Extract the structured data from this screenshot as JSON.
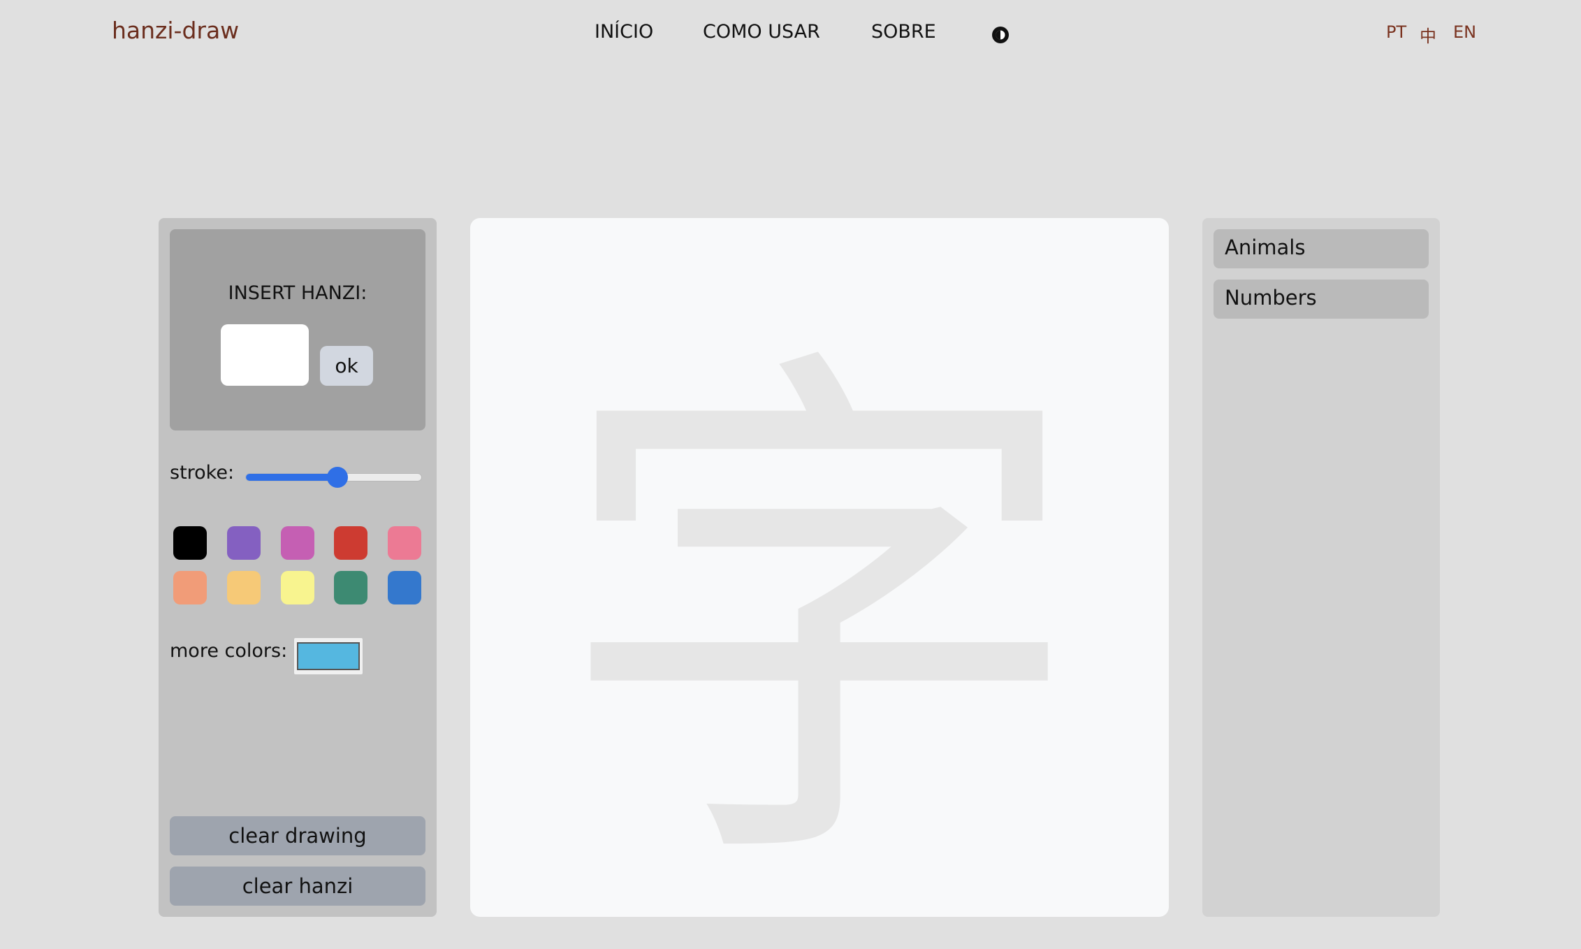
{
  "header": {
    "logo": "hanzi-draw",
    "nav": {
      "inicio": "INÍCIO",
      "como_usar": "COMO USAR",
      "sobre": "SOBRE"
    },
    "theme_icon": "contrast-icon",
    "languages": {
      "pt": "PT",
      "zh": "中",
      "en": "EN"
    }
  },
  "tools": {
    "insert_label": "INSERT HANZI:",
    "hanzi_value": "",
    "ok_label": "ok",
    "stroke_label": "stroke:",
    "stroke_value": 0.52,
    "palette": [
      "#000000",
      "#8460c1",
      "#c55fb3",
      "#cd3b31",
      "#ec7a94",
      "#f19c78",
      "#f6c977",
      "#f8f48f",
      "#3d8a72",
      "#3478cd"
    ],
    "more_colors_label": "more colors:",
    "custom_color": "#55b7e0",
    "clear_drawing_label": "clear drawing",
    "clear_hanzi_label": "clear hanzi"
  },
  "canvas": {
    "guide_character": "字",
    "guide_color": "#e6e6e6"
  },
  "categories": [
    {
      "label": "Animals"
    },
    {
      "label": "Numbers"
    }
  ]
}
